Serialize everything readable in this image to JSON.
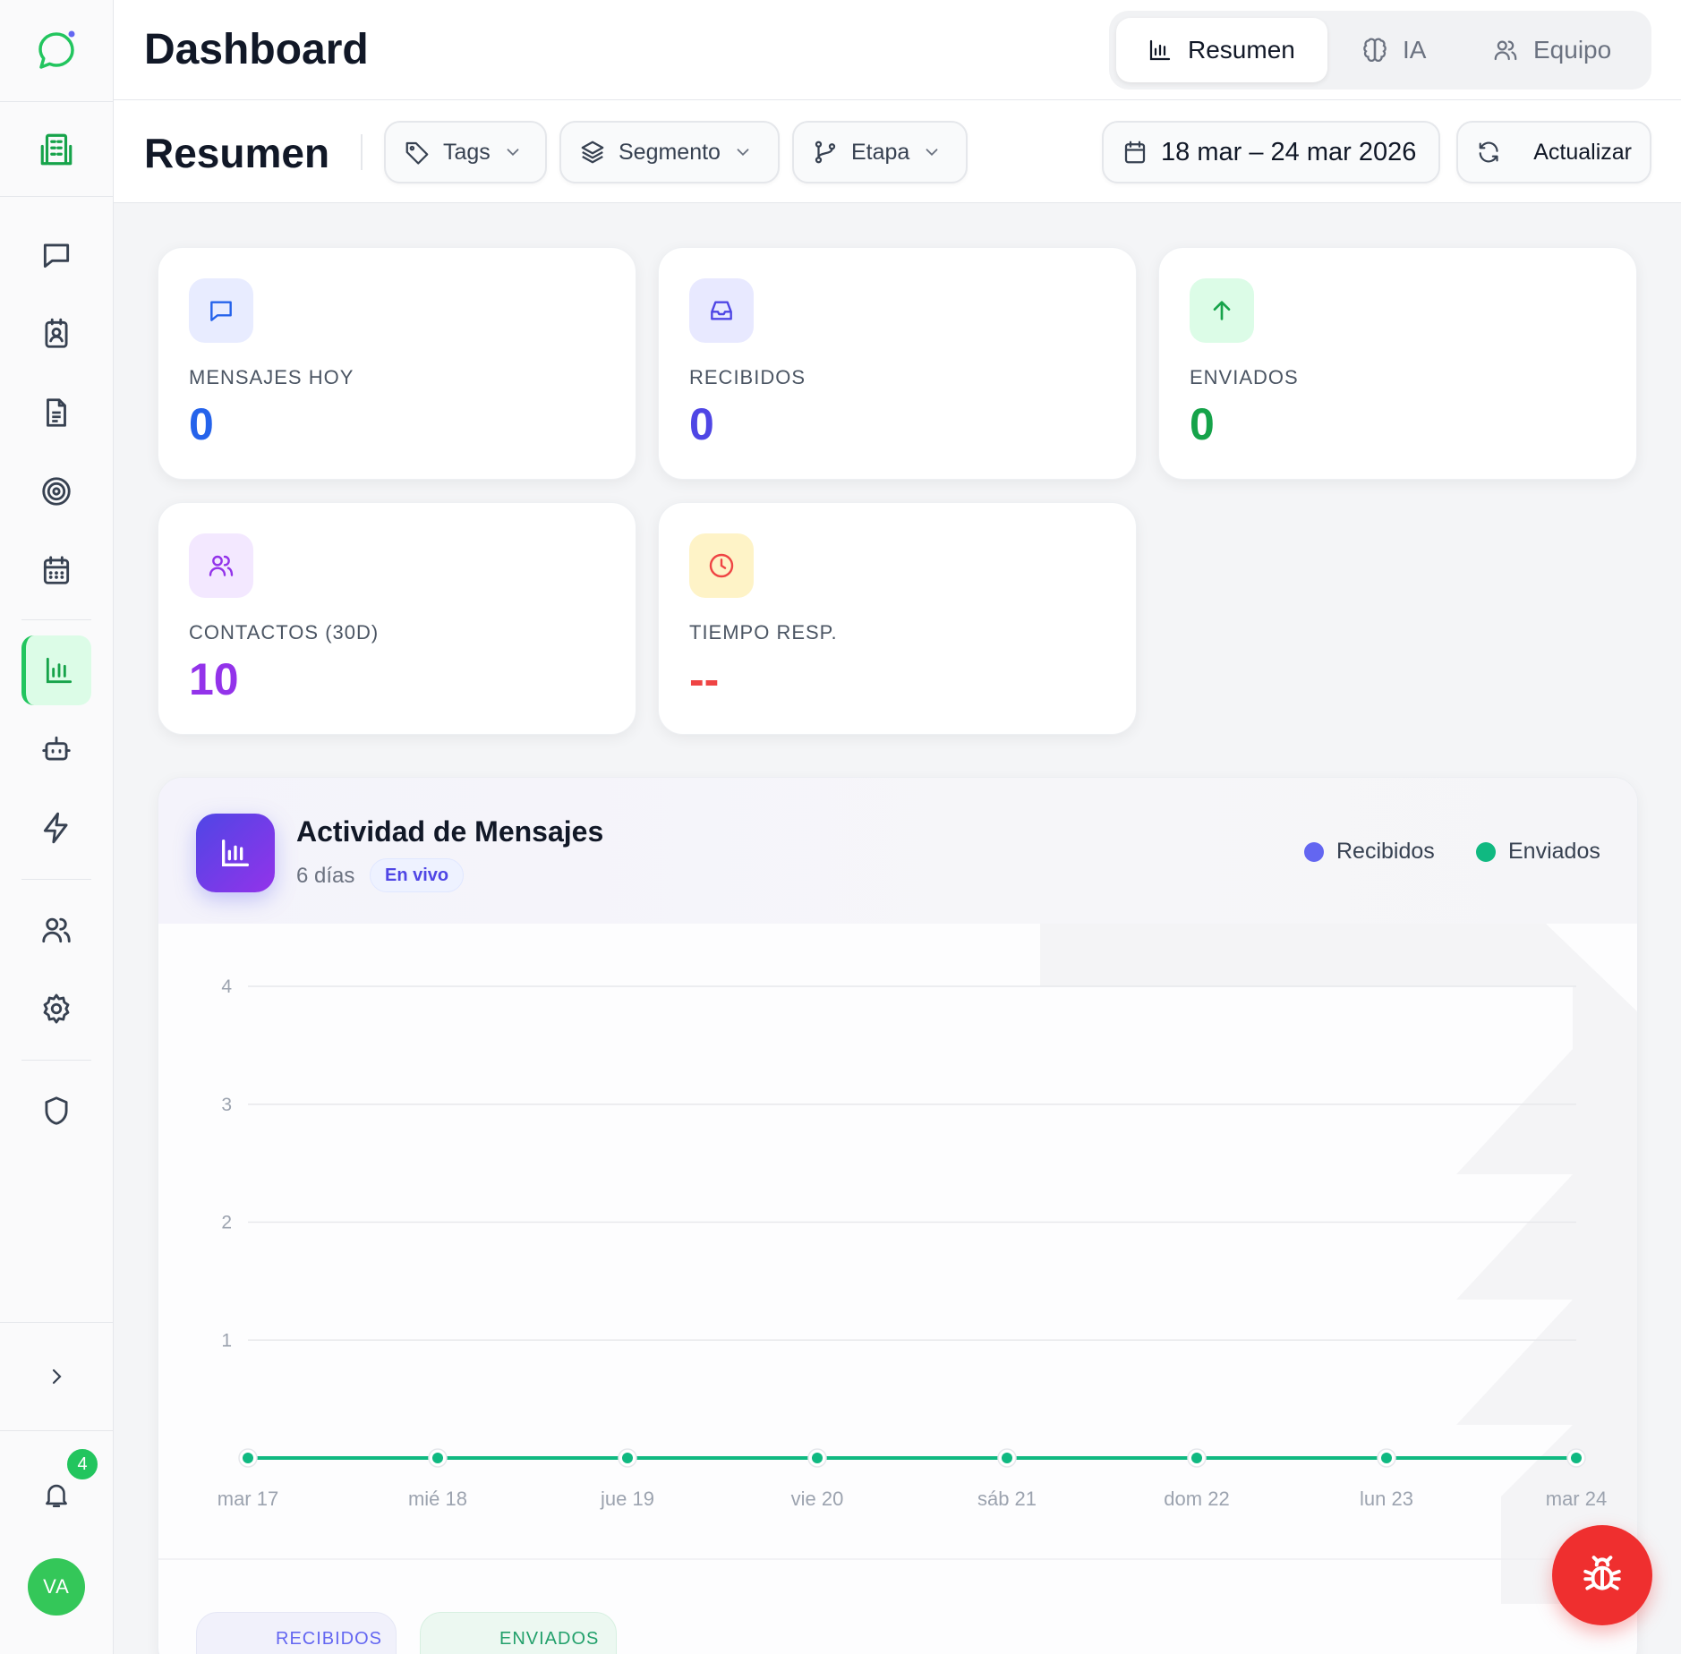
{
  "header": {
    "title": "Dashboard",
    "tabs": [
      {
        "label": "Resumen",
        "icon": "bar-chart-icon",
        "active": true
      },
      {
        "label": "IA",
        "icon": "brain-icon",
        "active": false
      },
      {
        "label": "Equipo",
        "icon": "users-icon",
        "active": false
      }
    ]
  },
  "filters": {
    "section_title": "Resumen",
    "tags_label": "Tags",
    "segment_label": "Segmento",
    "stage_label": "Etapa",
    "date_range": "18 mar – 24 mar 2026",
    "refresh_label": "Actualizar"
  },
  "sidebar": {
    "notifications_count": "4",
    "avatar_initials": "VA",
    "active_item": "analytics"
  },
  "stats": [
    {
      "label": "MENSAJES HOY",
      "value": "0",
      "color": "#2563eb",
      "icon": "message-icon"
    },
    {
      "label": "RECIBIDOS",
      "value": "0",
      "color": "#4f46e5",
      "icon": "inbox-icon"
    },
    {
      "label": "ENVIADOS",
      "value": "0",
      "color": "#16a34a",
      "icon": "arrow-up-icon"
    },
    {
      "label": "CONTACTOS (30D)",
      "value": "10",
      "color": "#9333ea",
      "icon": "users-icon"
    },
    {
      "label": "TIEMPO RESP.",
      "value": "--",
      "color": "#ef4444",
      "icon": "clock-icon"
    }
  ],
  "activity": {
    "title": "Actividad de Mensajes",
    "subtitle": "6 días",
    "live_label": "En vivo",
    "legend_received": "Recibidos",
    "legend_sent": "Enviados",
    "footer_received": "RECIBIDOS",
    "footer_sent": "ENVIADOS"
  },
  "colors": {
    "accent": "#22c55e",
    "received": "#6366f1",
    "sent": "#10b981",
    "danger": "#ef2f2f"
  },
  "chart_data": {
    "type": "line",
    "categories": [
      "mar 17",
      "mié 18",
      "jue 19",
      "vie 20",
      "sáb 21",
      "dom 22",
      "lun 23",
      "mar 24"
    ],
    "series": [
      {
        "name": "Recibidos",
        "values": [
          0,
          0,
          0,
          0,
          0,
          0,
          0,
          0
        ],
        "color": "#6366f1"
      },
      {
        "name": "Enviados",
        "values": [
          0,
          0,
          0,
          0,
          0,
          0,
          0,
          0
        ],
        "color": "#10b981"
      }
    ],
    "yticks": [
      "1",
      "2",
      "3",
      "4"
    ],
    "ylim": [
      0,
      4
    ],
    "grid": true,
    "legend_position": "top-right"
  }
}
